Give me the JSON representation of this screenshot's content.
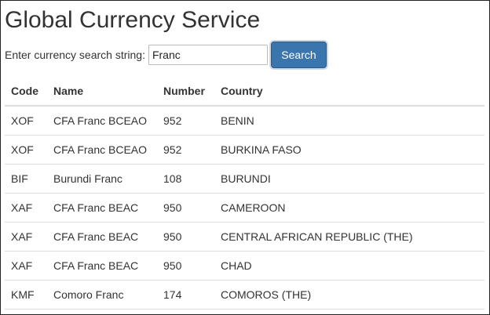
{
  "page": {
    "title": "Global Currency Service"
  },
  "search": {
    "label": "Enter currency search string:",
    "value": "Franc",
    "button_label": "Search"
  },
  "table": {
    "headers": {
      "code": "Code",
      "name": "Name",
      "number": "Number",
      "country": "Country"
    },
    "rows": [
      {
        "code": "XOF",
        "name": "CFA Franc BCEAO",
        "number": "952",
        "country": "BENIN"
      },
      {
        "code": "XOF",
        "name": "CFA Franc BCEAO",
        "number": "952",
        "country": "BURKINA FASO"
      },
      {
        "code": "BIF",
        "name": "Burundi Franc",
        "number": "108",
        "country": "BURUNDI"
      },
      {
        "code": "XAF",
        "name": "CFA Franc BEAC",
        "number": "950",
        "country": "CAMEROON"
      },
      {
        "code": "XAF",
        "name": "CFA Franc BEAC",
        "number": "950",
        "country": "CENTRAL AFRICAN REPUBLIC (THE)"
      },
      {
        "code": "XAF",
        "name": "CFA Franc BEAC",
        "number": "950",
        "country": "CHAD"
      },
      {
        "code": "KMF",
        "name": "Comoro Franc",
        "number": "174",
        "country": "COMOROS (THE)"
      }
    ]
  },
  "colors": {
    "button_background": "#3a76ad",
    "button_text": "#ffffff",
    "text": "#333333",
    "row_divider": "#dddddd"
  }
}
